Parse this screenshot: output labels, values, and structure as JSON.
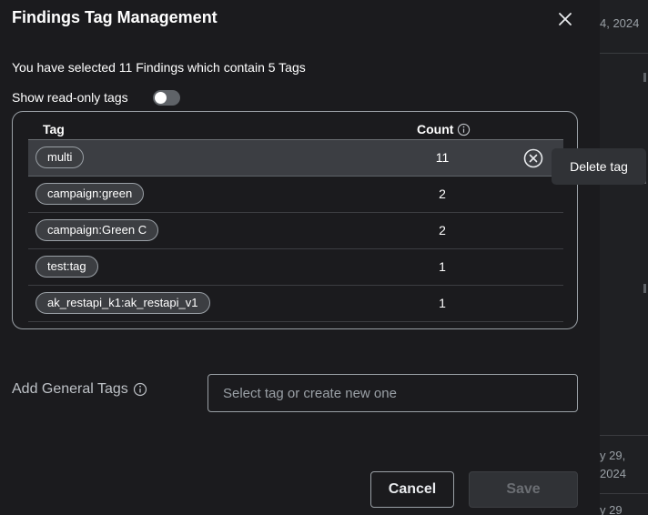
{
  "background": {
    "date_top": "4, 2024",
    "date_mid_line1": "y 29,",
    "date_mid_line2": "2024",
    "date_bottom": "y 29"
  },
  "modal": {
    "title": "Findings Tag Management",
    "summary": "You have selected 11 Findings which contain 5 Tags",
    "show_readonly_label": "Show read-only tags",
    "show_readonly_on": false
  },
  "table": {
    "headers": {
      "tag": "Tag",
      "count": "Count"
    },
    "rows": [
      {
        "tag": "multi",
        "count": "11"
      },
      {
        "tag": "campaign:green",
        "count": "2"
      },
      {
        "tag": "campaign:Green C",
        "count": "2"
      },
      {
        "tag": "test:tag",
        "count": "1"
      },
      {
        "tag": "ak_restapi_k1:ak_restapi_v1",
        "count": "1"
      }
    ]
  },
  "tooltip": {
    "text": "Delete tag"
  },
  "add_tags": {
    "label": "Add General Tags",
    "placeholder": "Select tag or create new one",
    "value": ""
  },
  "footer": {
    "cancel_label": "Cancel",
    "save_label": "Save"
  },
  "colors": {
    "modal_bg": "#1b1b1e",
    "selected_row": "#3c3e43",
    "border": "#9aa0a6"
  },
  "icons": {
    "close": "close-icon",
    "info": "info-icon",
    "delete": "circle-x-icon"
  }
}
